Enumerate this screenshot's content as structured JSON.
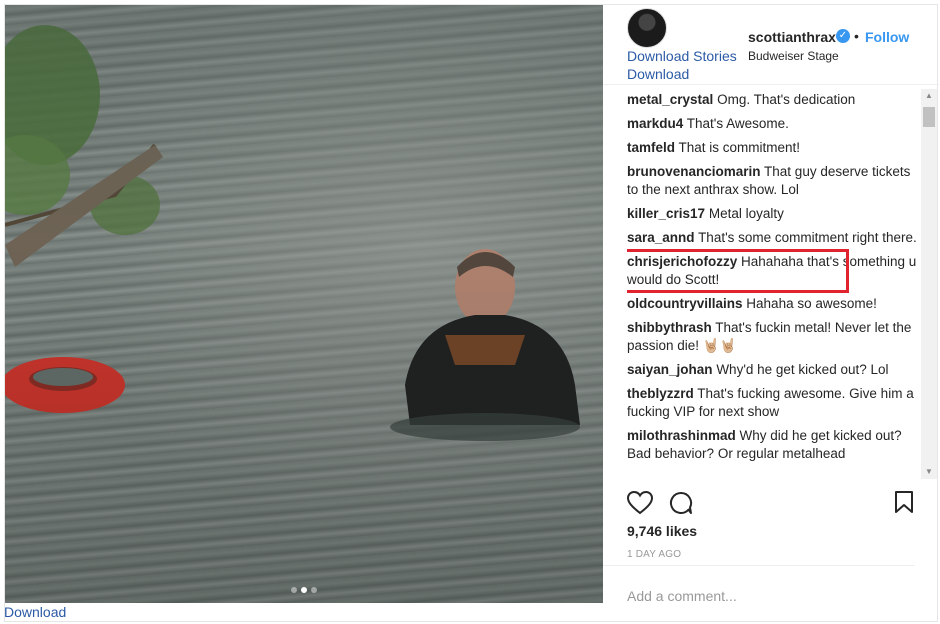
{
  "header": {
    "username": "scottianthrax",
    "follow_label": "Follow",
    "separator": "•",
    "location": "Budweiser Stage",
    "link_stories": "Download Stories",
    "link_download": "Download"
  },
  "comments": [
    {
      "user": "metal_crystal",
      "text": "Omg. That's dedication"
    },
    {
      "user": "markdu4",
      "text": "That's Awesome."
    },
    {
      "user": "tamfeld",
      "text": "That is commitment!"
    },
    {
      "user": "brunovenanciomarin",
      "text": "That guy deserve tickets to the next anthrax show. Lol"
    },
    {
      "user": "killer_cris17",
      "text": "Metal loyalty"
    },
    {
      "user": "sara_annd",
      "text": "That's some commitment right there."
    },
    {
      "user": "chrisjerichofozzy",
      "text": "Hahahaha that's something u would do Scott!"
    },
    {
      "user": "oldcountryvillains",
      "text": "Hahaha so awesome!"
    },
    {
      "user": "shibbythrash",
      "text": "That's fuckin metal! Never let the passion die! 🤘🏼🤘🏼"
    },
    {
      "user": "saiyan_johan",
      "text": "Why'd he get kicked out? Lol"
    },
    {
      "user": "theblyzzrd",
      "text": "That's fucking awesome. Give him a fucking VIP for next show"
    },
    {
      "user": "milothrashinmad",
      "text": "Why did he get kicked out? Bad behavior? Or regular metalhead"
    }
  ],
  "likes": "9,746 likes",
  "timestamp": "1 DAY AGO",
  "add_comment_placeholder": "Add a comment...",
  "bottom_link": "Download",
  "icons": {
    "verified": "verified-badge-icon",
    "like": "heart-icon",
    "comment": "speech-bubble-icon",
    "save": "bookmark-icon"
  },
  "colors": {
    "accent": "#3897f0",
    "link": "#2b5aa6",
    "highlight_box": "#e0242f"
  }
}
